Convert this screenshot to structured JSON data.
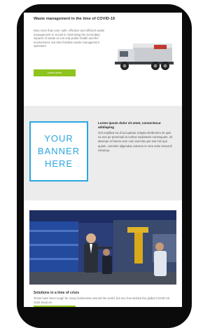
{
  "card1": {
    "title": "Waste management in the time of COVID-19",
    "body": "Now more than ever, safe, effective and efficient waste management is crucial in minimising the secondary impacts of waste on not only public health and the environment, but also frontline waste management operators.",
    "button_label": "Learn More"
  },
  "banner": {
    "text": "YOUR BANNER HERE"
  },
  "card2": {
    "title": "Lorem ipsum dolor sit amet, consectecur adidiaping",
    "body": "Ord explibus ea di accuptatur sclupta similectem int quis ea non pe poremodi at corbus repriatenis nonsequam, sit aborepe et harum eum cum exercita que sus min quo quiam, commim aligendae volorero te vere solor simuscil estumqu."
  },
  "card3": {
    "title": "Solutions in a time of crisis",
    "body": "Times have been tough for many businesses around the world, but one has tackled the global COVID-19 crisis head on."
  },
  "colors": {
    "accent_green": "#8fc31f",
    "banner_blue": "#2aa7e0",
    "frame_black": "#0b0b0b"
  }
}
